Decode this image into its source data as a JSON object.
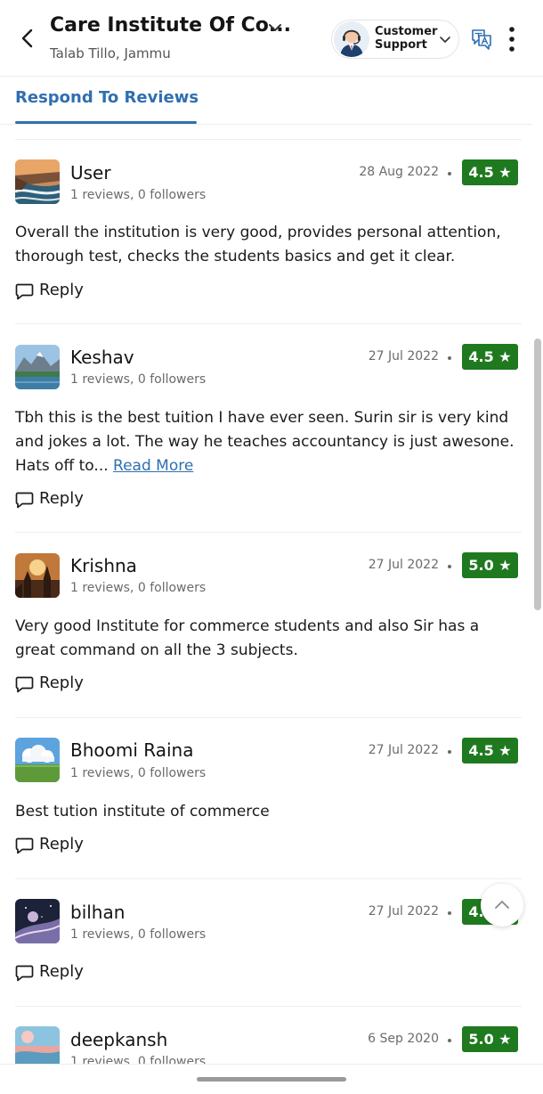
{
  "header": {
    "business_name": "Care Institute Of Co...",
    "location": "Talab Tillo, Jammu",
    "support_label_line1": "Customer",
    "support_label_line2": "Support"
  },
  "tabs": {
    "active": "Respond To Reviews"
  },
  "reply_label": "Reply",
  "reviews": [
    {
      "name": "User",
      "meta": "1 reviews, 0 followers",
      "date": "28 Aug 2022",
      "rating": "4.5 ★",
      "text": "Overall the institution is very good, provides personal attention, thorough test, checks the students basics and get it clear."
    },
    {
      "name": "Keshav",
      "meta": "1 reviews, 0 followers",
      "date": "27 Jul 2022",
      "rating": "4.5 ★",
      "text": "Tbh this is the best tuition I have ever seen. Surin sir is very kind and jokes a lot. The way he teaches accountancy is just awesone. Hats off to... ",
      "read_more": "Read More"
    },
    {
      "name": "Krishna",
      "meta": "1 reviews, 0 followers",
      "date": "27 Jul 2022",
      "rating": "5.0 ★",
      "text": "Very good Institute for commerce students and also Sir has a great command on all the 3 subjects."
    },
    {
      "name": "Bhoomi Raina",
      "meta": "1 reviews, 0 followers",
      "date": "27 Jul 2022",
      "rating": "4.5 ★",
      "text": "Best tution institute of commerce"
    },
    {
      "name": "bilhan",
      "meta": "1 reviews, 0 followers",
      "date": "27 Jul 2022",
      "rating": "4.5 ★",
      "text": ""
    },
    {
      "name": "deepkansh",
      "meta": "1 reviews, 0 followers",
      "date": "6 Sep 2020",
      "rating": "5.0 ★",
      "text": ""
    }
  ],
  "colors": {
    "accent": "#2f6fb0",
    "rating_bg": "#1f7a1f"
  },
  "icons": [
    "back-arrow-icon",
    "chevron-down-icon",
    "support-agent-icon",
    "translate-icon",
    "more-vertical-icon",
    "reply-bubble-icon",
    "chevron-up-icon"
  ]
}
